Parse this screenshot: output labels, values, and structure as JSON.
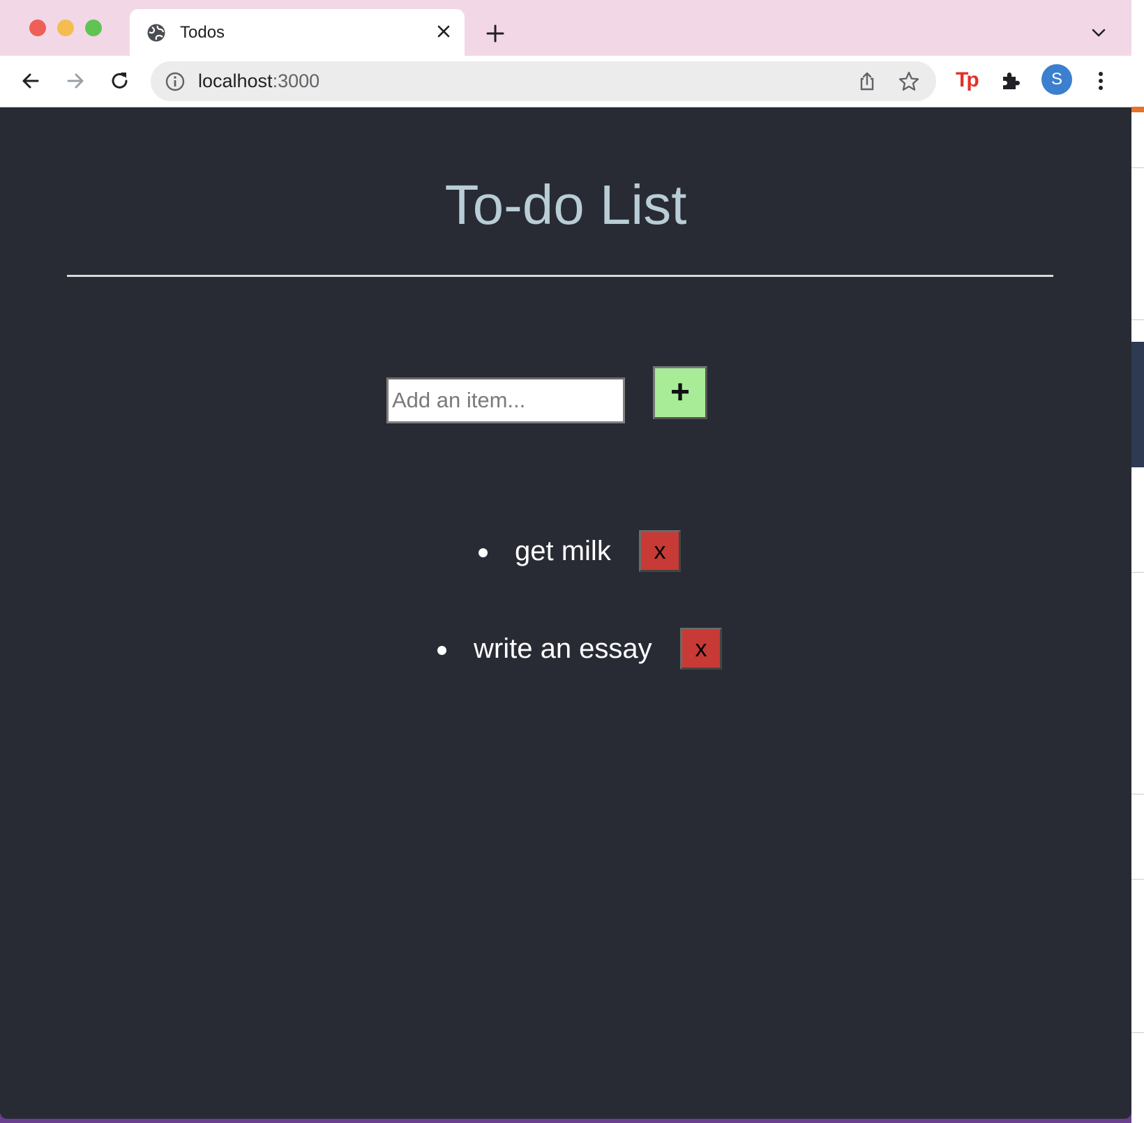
{
  "browser": {
    "tab": {
      "title": "Todos"
    },
    "address_bar": {
      "host": "localhost",
      "port": ":3000"
    },
    "extensions": {
      "tp_label": "Tp"
    },
    "profile": {
      "initial": "S"
    }
  },
  "app": {
    "title": "To-do List",
    "input": {
      "placeholder": "Add an item...",
      "value": ""
    },
    "add_button_label": "+",
    "items": [
      {
        "text": "get milk",
        "delete_label": "x"
      },
      {
        "text": "write an essay",
        "delete_label": "x"
      }
    ]
  },
  "colors": {
    "page_background": "#282b34",
    "title": "#b9cdd6",
    "add_button": "#a8ec98",
    "delete_button": "#c73a35",
    "tab_bar": "#f2d8e6"
  }
}
